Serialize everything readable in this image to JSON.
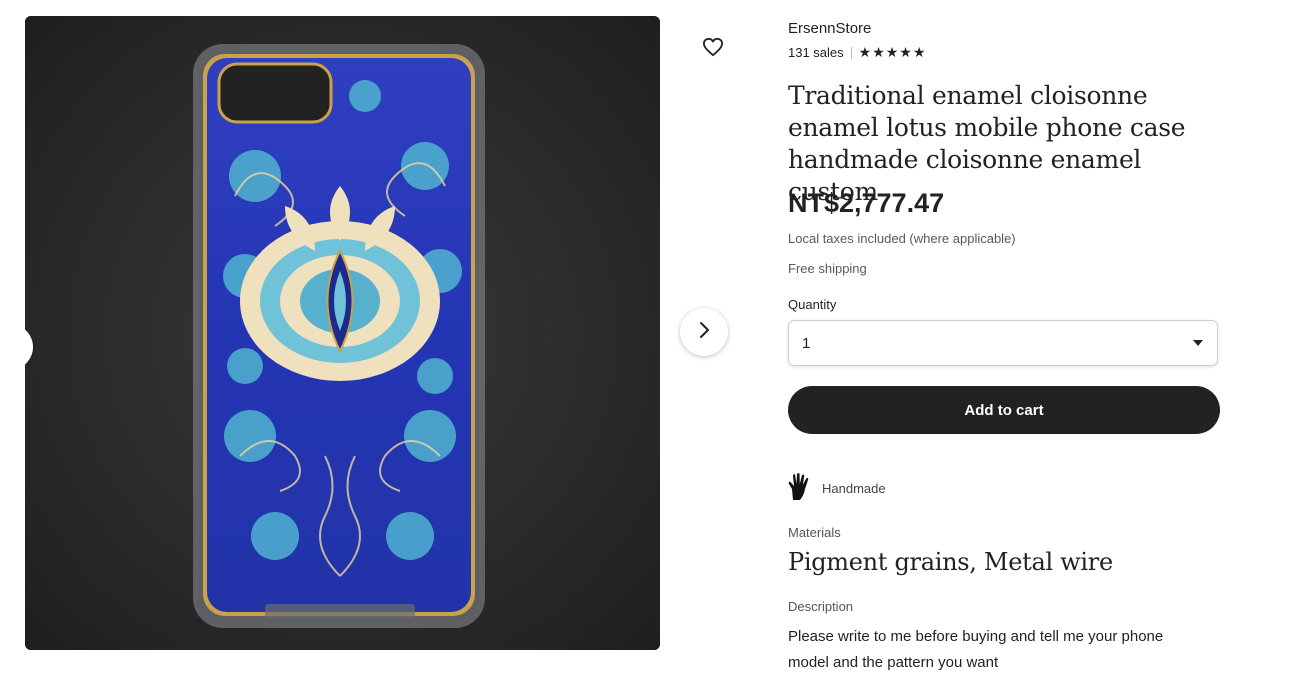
{
  "shop": {
    "name": "ErsennStore",
    "sales": "131 sales",
    "rating_stars": "★★★★★"
  },
  "product": {
    "title": "Traditional enamel cloisonne enamel lotus mobile phone case handmade cloisonne enamel custom",
    "price": "NT$2,777.47",
    "tax_note": "Local taxes included (where applicable)",
    "shipping": "Free shipping"
  },
  "quantity": {
    "label": "Quantity",
    "selected": "1"
  },
  "actions": {
    "add_to_cart": "Add to cart"
  },
  "badges": {
    "handmade": "Handmade"
  },
  "materials": {
    "label": "Materials",
    "value": "Pigment grains, Metal wire"
  },
  "description": {
    "label": "Description",
    "text": "Please write to me before buying and tell me your phone model and the pattern you want"
  },
  "icons": {
    "favorite": "heart-icon",
    "next": "chevron-right-icon",
    "handmade": "hand-icon",
    "dropdown": "caret-down-icon"
  },
  "colors": {
    "primary_button": "#222222",
    "text": "#222222",
    "muted_text": "#595959"
  }
}
